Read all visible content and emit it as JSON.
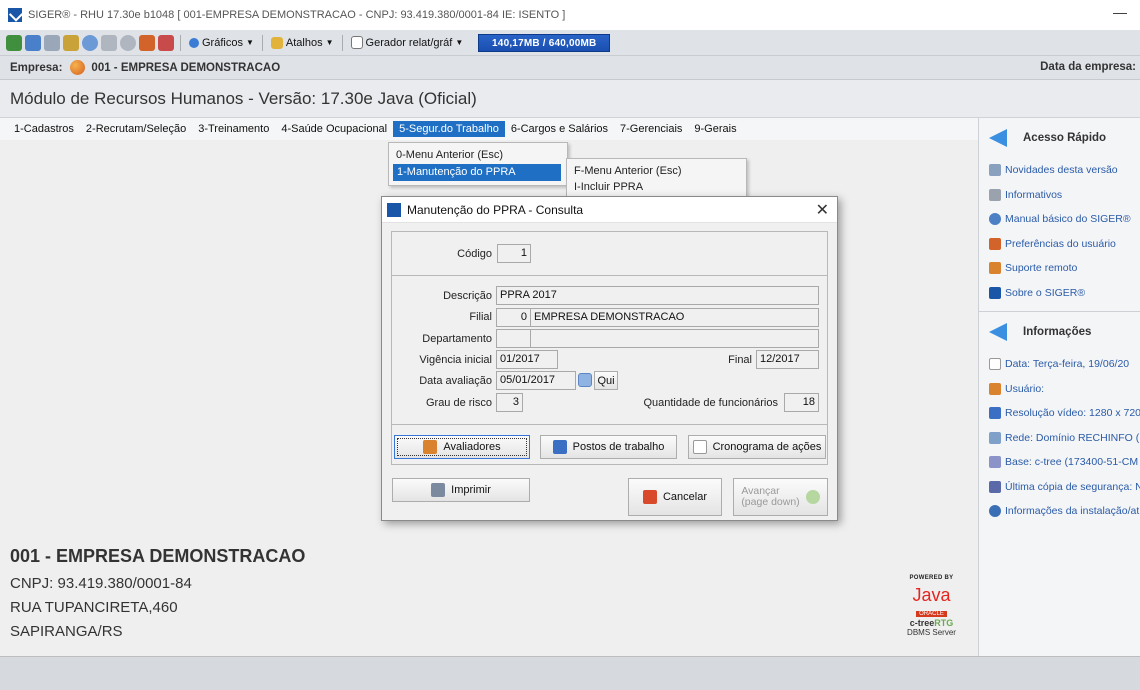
{
  "window": {
    "title": "SIGER® - RHU 17.30e b1048 [ 001-EMPRESA DEMONSTRACAO - CNPJ: 93.419.380/0001-84 IE: ISENTO ]",
    "minimize_glyph": "—"
  },
  "toolbar": {
    "graficos_label": "Gráficos",
    "atalhos_label": "Atalhos",
    "gerador_label": "Gerador relat/gráf",
    "memory": "140,17MB / 640,00MB"
  },
  "empresa_bar": {
    "label": "Empresa:",
    "value": "001 - EMPRESA DEMONSTRACAO",
    "right_label": "Data da empresa:"
  },
  "module_title": "Módulo de Recursos Humanos - Versão: 17.30e Java (Oficial)",
  "menu": {
    "items": [
      {
        "label": "1-Cadastros"
      },
      {
        "label": "2-Recrutam/Seleção"
      },
      {
        "label": "3-Treinamento"
      },
      {
        "label": "4-Saúde Ocupacional"
      },
      {
        "label": "5-Segur.do Trabalho"
      },
      {
        "label": "6-Cargos e Salários"
      },
      {
        "label": "7-Gerenciais"
      },
      {
        "label": "9-Gerais"
      }
    ],
    "submenu": [
      "0-Menu Anterior (Esc)",
      "1-Manutenção do PPRA"
    ],
    "submenu2": [
      "F-Menu Anterior (Esc)",
      "I-Incluir PPRA"
    ]
  },
  "dialog": {
    "title": "Manutenção do PPRA - Consulta",
    "close_glyph": "✕",
    "codigo_label": "Código",
    "codigo": "1",
    "descricao_label": "Descrição",
    "descricao": "PPRA 2017",
    "filial_label": "Filial",
    "filial_code": "0",
    "filial_name": "EMPRESA DEMONSTRACAO",
    "departamento_label": "Departamento",
    "vigencia_label": "Vigência inicial",
    "vigencia": "01/2017",
    "final_label": "Final",
    "final": "12/2017",
    "data_aval_label": "Data avaliação",
    "data_aval": "05/01/2017",
    "qui_label": "Qui",
    "grau_label": "Grau de risco",
    "grau": "3",
    "qtd_label": "Quantidade de funcionários",
    "qtd": "18",
    "btn_avaliadores": "Avaliadores",
    "btn_postos": "Postos de trabalho",
    "btn_cronograma": "Cronograma de ações",
    "btn_imprimir": "Imprimir",
    "btn_cancelar": "Cancelar",
    "btn_avancar_1": "Avançar",
    "btn_avancar_2": "(page down)"
  },
  "company": {
    "name": "001 - EMPRESA DEMONSTRACAO",
    "cnpj": "CNPJ: 93.419.380/0001-84",
    "address": "RUA TUPANCIRETA,460",
    "city": "SAPIRANGA/RS"
  },
  "powered": {
    "by": "POWERED BY",
    "java": "Java",
    "oracle": "ORACLE",
    "ctree": "c-tree",
    "rtg": "RTG",
    "dbms": "DBMS Server"
  },
  "right_panel": {
    "acesso_title": "Acesso Rápido",
    "acesso_items": [
      "Novidades desta versão",
      "Informativos",
      "Manual básico do SIGER®",
      "Preferências do usuário",
      "Suporte remoto",
      "Sobre o SIGER®"
    ],
    "info_title": "Informações",
    "info_items": [
      "Data: Terça-feira, 19/06/20",
      "Usuário:",
      "Resolução vídeo: 1280 x 720",
      "Rede: Domínio RECHINFO ( 1",
      "Base: c-tree (173400-51-CM",
      "Última cópia de segurança: N",
      "Informações da instalação/at"
    ]
  },
  "colors": {
    "accent": "#1f6fc5",
    "link": "#2a5ba8"
  }
}
